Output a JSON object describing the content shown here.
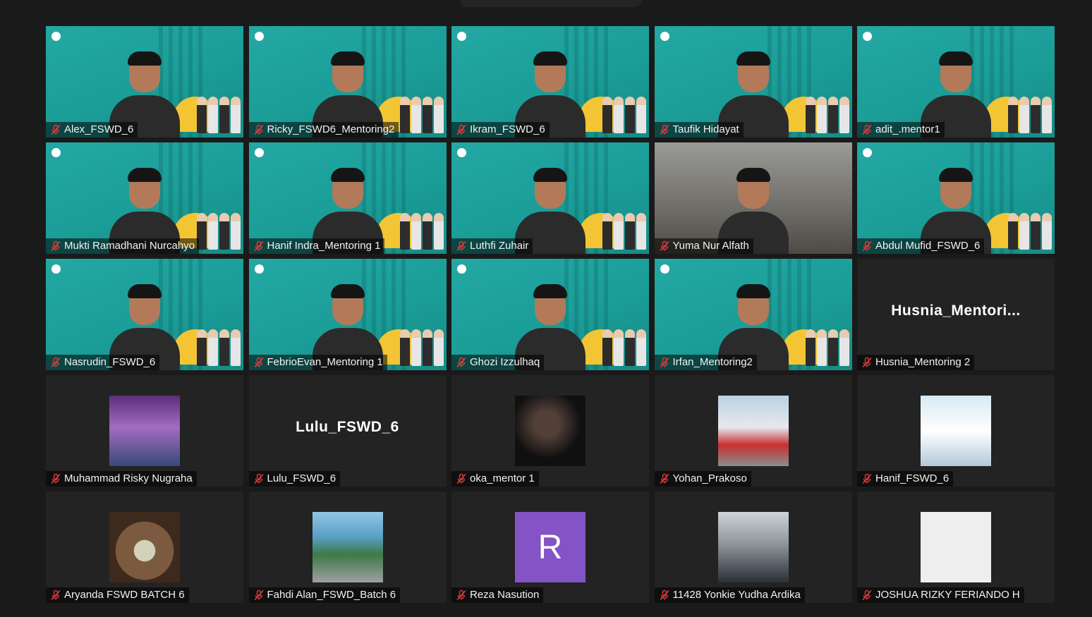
{
  "participants": [
    {
      "name": "Alex_FSWD_6",
      "type": "video",
      "muted": true
    },
    {
      "name": "Ricky_FSWD6_Mentoring2",
      "type": "video",
      "muted": true
    },
    {
      "name": "Ikram_FSWD_6",
      "type": "video",
      "muted": true
    },
    {
      "name": "Taufik Hidayat",
      "type": "video",
      "muted": true
    },
    {
      "name": "adit_.mentor1",
      "type": "video",
      "muted": true
    },
    {
      "name": "Mukti Ramadhani Nurcahyo",
      "type": "video",
      "muted": true
    },
    {
      "name": "Hanif Indra_Mentoring 1",
      "type": "video",
      "muted": true
    },
    {
      "name": "Luthfi Zuhair",
      "type": "video",
      "muted": true
    },
    {
      "name": "Yuma Nur Alfath",
      "type": "video-room",
      "muted": true
    },
    {
      "name": "Abdul Mufid_FSWD_6",
      "type": "video",
      "muted": true
    },
    {
      "name": "Nasrudin_FSWD_6",
      "type": "video",
      "muted": true
    },
    {
      "name": "FebrioEvan_Mentoring 1",
      "type": "video",
      "muted": true
    },
    {
      "name": "Ghozi Izzulhaq",
      "type": "video",
      "muted": true
    },
    {
      "name": "Irfan_Mentoring2",
      "type": "video",
      "muted": true
    },
    {
      "name": "Husnia_Mentoring 2",
      "type": "name-only",
      "display_text": "Husnia_Mentori...",
      "muted": true
    },
    {
      "name": "Muhammad Risky Nugraha",
      "type": "avatar",
      "avatar_style": "game",
      "muted": true
    },
    {
      "name": "Lulu_FSWD_6",
      "type": "name-only",
      "display_text": "Lulu_FSWD_6",
      "muted": true
    },
    {
      "name": "oka_mentor 1",
      "type": "avatar",
      "avatar_style": "dark",
      "muted": true
    },
    {
      "name": "Yohan_Prakoso",
      "type": "avatar",
      "avatar_style": "snow",
      "muted": true
    },
    {
      "name": "Hanif_FSWD_6",
      "type": "avatar",
      "avatar_style": "anime",
      "muted": true
    },
    {
      "name": "Aryanda FSWD BATCH 6",
      "type": "avatar",
      "avatar_style": "cartoon",
      "muted": true
    },
    {
      "name": "Fahdi Alan_FSWD_Batch 6",
      "type": "avatar",
      "avatar_style": "outdoor",
      "muted": true
    },
    {
      "name": "Reza Nasution",
      "type": "initial",
      "initial": "R",
      "muted": true
    },
    {
      "name": "11428 Yonkie Yudha Ardika",
      "type": "avatar",
      "avatar_style": "office",
      "muted": true
    },
    {
      "name": "JOSHUA RIZKY FERIANDO H",
      "type": "avatar",
      "avatar_style": "sketch",
      "muted": true
    }
  ],
  "colors": {
    "background": "#1a1a1a",
    "tile": "#232323",
    "virtual_bg": "#1b9d98",
    "muted_icon": "#e03a3a",
    "initial_avatar": "#8453c6"
  },
  "icons": {
    "muted": "mic-muted-icon"
  }
}
